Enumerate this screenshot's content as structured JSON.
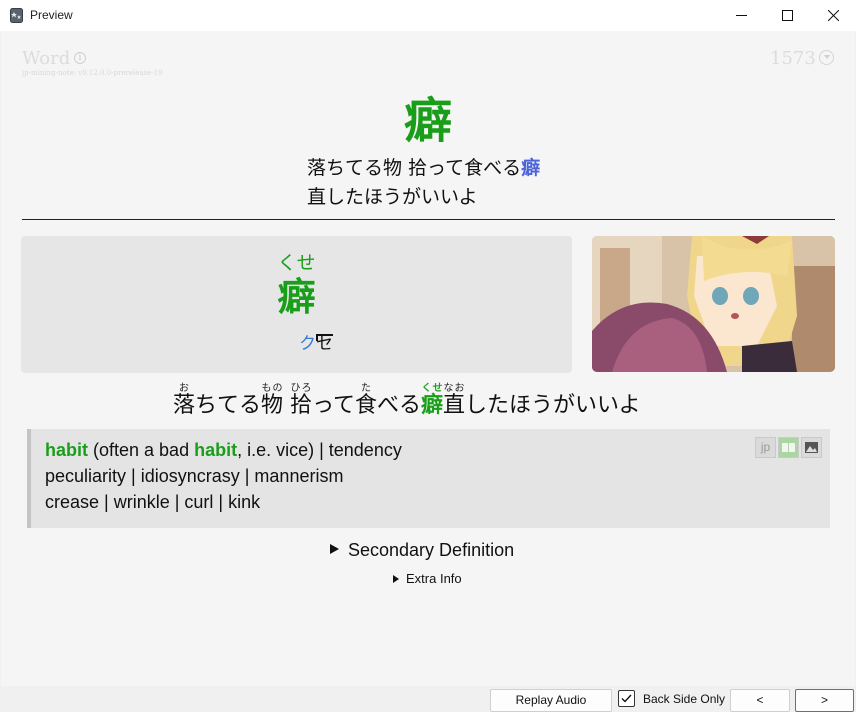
{
  "window": {
    "title": "Preview",
    "minimize_icon": "minimize-icon",
    "maximize_icon": "maximize-icon",
    "close_icon": "close-icon"
  },
  "card_header": {
    "note_type": "Word",
    "version": "jp-mining-note: v0.12.0.0-prerelease-19",
    "card_id": "1573"
  },
  "front": {
    "word": "癖",
    "sentence_part1": "落ちてる物 拾って食べる",
    "sentence_highlight": "癖",
    "sentence_line2": "直したほうがいいよ"
  },
  "back": {
    "reading": "くせ",
    "word": "癖",
    "pitch_low": "ク",
    "pitch_high": "セ",
    "sentence": [
      {
        "base": "落",
        "ruby": "お"
      },
      {
        "text": "ちてる"
      },
      {
        "base": "物",
        "ruby": "もの"
      },
      {
        "text": " "
      },
      {
        "base": "拾",
        "ruby": "ひろ"
      },
      {
        "text": "って"
      },
      {
        "base": "食",
        "ruby": "た"
      },
      {
        "text": "べる"
      },
      {
        "base": "癖",
        "ruby": "くせ",
        "hl": true
      },
      {
        "base": "直",
        "ruby": "なお"
      },
      {
        "text": "したほうがいいよ"
      }
    ]
  },
  "definition": {
    "line1_hl1": "habit",
    "line1_mid": " (often a bad ",
    "line1_hl2": "habit",
    "line1_rest": ", i.e. vice) | tendency",
    "line2": "peculiarity | idiosyncrasy | mannerism",
    "line3": "crease | wrinkle | curl | kink",
    "icon_jp": "jp"
  },
  "collapsibles": {
    "secondary": "Secondary Definition",
    "extra": "Extra Info"
  },
  "bottom_bar": {
    "replay_audio": "Replay Audio",
    "back_side_only": "Back Side Only",
    "prev": "<",
    "next": ">"
  },
  "colors": {
    "accent_green": "#1a9e1a",
    "highlight_blue": "#4d63d8",
    "pitch_blue": "#3a78d8"
  }
}
